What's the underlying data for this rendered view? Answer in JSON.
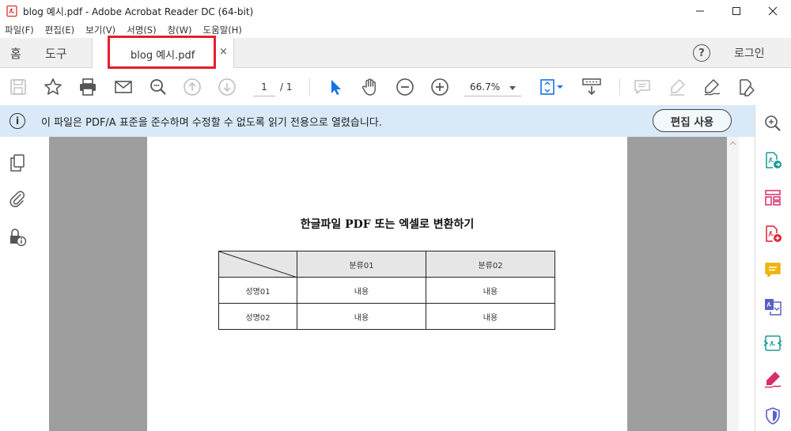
{
  "window": {
    "title": "blog 예시.pdf - Adobe Acrobat Reader DC (64-bit)",
    "minimize": "—",
    "maximize": "☐",
    "close": "✕"
  },
  "menu": [
    "파일(F)",
    "편집(E)",
    "보기(V)",
    "서명(S)",
    "창(W)",
    "도움말(H)"
  ],
  "tabs": {
    "home": "홈",
    "tools": "도구",
    "document": "blog 예시.pdf",
    "close": "×"
  },
  "header_right": {
    "help": "?",
    "login": "로그인"
  },
  "toolbar": {
    "page_current": "1",
    "page_total": "/ 1",
    "zoom": "66.7%",
    "icons": [
      "save-icon",
      "star-icon",
      "print-icon",
      "mail-icon",
      "search-icon",
      "prev-page-icon",
      "next-page-icon",
      "select-cursor-icon",
      "hand-tool-icon",
      "zoom-out-icon",
      "zoom-in-icon",
      "fit-page-icon",
      "scroll-mode-icon",
      "comment-icon",
      "highlight-icon",
      "sign-icon",
      "fill-sign-icon"
    ]
  },
  "infobar": {
    "icon": "i",
    "message": "이 파일은 PDF/A 표준을 준수하며 수정할 수 없도록 읽기 전용으로 열렸습니다.",
    "button": "편집 사용"
  },
  "document": {
    "title": "한글파일 PDF 또는 엑셀로 변환하기",
    "table": {
      "headers": [
        "",
        "분류01",
        "분류02"
      ],
      "rows": [
        [
          "성명01",
          "내용",
          "내용"
        ],
        [
          "성명02",
          "내용",
          "내용"
        ]
      ]
    }
  },
  "colors": {
    "accent_blue": "#1473e6",
    "highlight_red": "#e0202a",
    "infobar_bg": "#d9e9f7"
  }
}
